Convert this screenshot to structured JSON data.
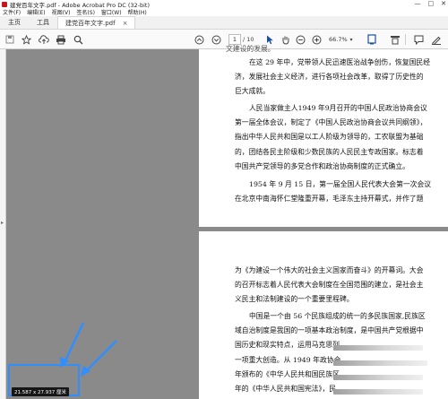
{
  "window": {
    "title": "建党百年文字.pdf - Adobe Acrobat Pro DC (32-bit)",
    "controls": [
      "—",
      "□",
      "✕"
    ]
  },
  "menu": [
    "文件(F)",
    "编辑(E)",
    "视图(V)",
    "签名(S)",
    "窗口(W)",
    "帮助(H)"
  ],
  "tabs": {
    "home": "主页",
    "tools": "工具",
    "document": "建党百年文字.pdf",
    "close": "×"
  },
  "toolbar": {
    "page_current": "1",
    "page_total": "/ 10",
    "zoom": "66.7%"
  },
  "page1_lines": [
    "文建设的发展。",
    "在这 29 年中，党带领人民迅速医治战争创伤，恢复国民经",
    "济，发展社会主义经济，进行各项社会改革，取得了历史性的",
    "巨大成就。",
    "人民当家做主人1949 年9月召开的中国人民政治协商会议",
    "第一届全体会议，制定了《中国人民政治协商会议共同纲领》，",
    "指出中华人民共和国是以工人阶级为领导的，工农联盟为基础",
    "的，团结各民主阶级和少数民族的人民民主专政国家。标志着",
    "中国共产党领导的多党合作和政治协商制度的正式确立。",
    "1954 年 9 月 15 日，第一届全国人民代表大会第一次会议",
    "在北京中南海怀仁堂隆重开幕，毛泽东主持开幕式，并作了题"
  ],
  "page2_lines": [
    "为《为建设一个伟大的社会主义国家而奋斗》的开幕词。大会",
    "的召开标志着人民代表大会制度在全国范围的建立，是社会主",
    "义民主和法制建设的一个重要里程碑。",
    "中国是一个由 56 个民族组成的统一的多民族国家,民族区",
    "域自治制度是我国的一项基本政治制度，是中国共产党根据中",
    "国历史和现实特点，运用马克思列",
    "一项重大创造。从 1949 年政协会",
    "年颁布的《中华人民共和国民族区",
    "年的《中华人民共和国宪法》，民"
  ],
  "status": {
    "dimensions": "21.587 x 27.937 厘米"
  }
}
